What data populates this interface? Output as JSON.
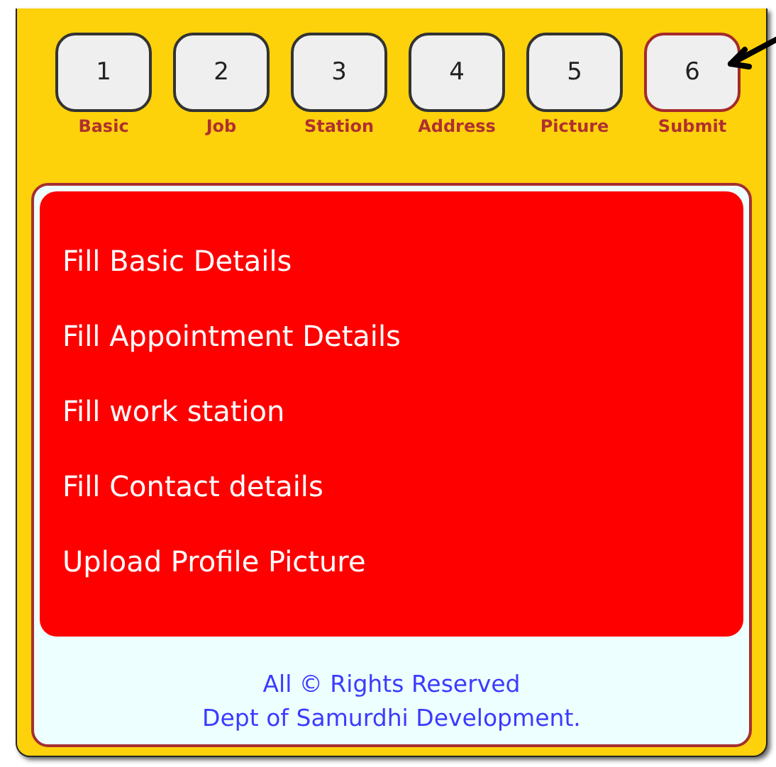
{
  "steps": [
    {
      "number": "1",
      "label": "Basic",
      "selected": false
    },
    {
      "number": "2",
      "label": "Job",
      "selected": false
    },
    {
      "number": "3",
      "label": "Station",
      "selected": false
    },
    {
      "number": "4",
      "label": "Address",
      "selected": false
    },
    {
      "number": "5",
      "label": "Picture",
      "selected": false
    },
    {
      "number": "6",
      "label": "Submit",
      "selected": true
    }
  ],
  "tasks": [
    "Fill Basic Details",
    "Fill Appointment Details",
    "Fill work station",
    "Fill Contact details",
    "Upload Profile Picture"
  ],
  "footer": [
    "All © Rights Reserved",
    "Dept of Samurdhi Development."
  ]
}
